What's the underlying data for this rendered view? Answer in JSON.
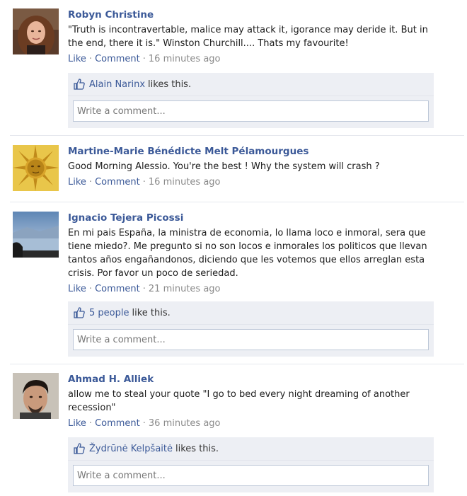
{
  "posts": [
    {
      "author": "Robyn Christine",
      "text": "\"Truth is incontravertable, malice may attack it, igorance may deride it. But in the end, there it is.\" Winston Churchill.... Thats my favourite!",
      "like_label": "Like",
      "comment_label": "Comment",
      "time": "16 minutes ago",
      "likers": "Alain Narinx",
      "likes_suffix": "likes this.",
      "comment_placeholder": "Write a comment..."
    },
    {
      "author": "Martine-Marie Bénédicte Melt Pélamourgues",
      "text": "Good Morning Alessio. You're the best ! Why the system will crash ?",
      "like_label": "Like",
      "comment_label": "Comment",
      "time": "16 minutes ago"
    },
    {
      "author": "Ignacio Tejera Picossi",
      "text": "En mi pais España, la ministra de economia, lo llama loco e inmoral, sera que tiene miedo?. Me pregunto si no son locos e inmorales los politicos que llevan tantos años engañandonos, diciendo que les votemos que ellos arreglan esta crisis. Por favor un poco de seriedad.",
      "like_label": "Like",
      "comment_label": "Comment",
      "time": "21 minutes ago",
      "likers": "5 people",
      "likes_suffix": "like this.",
      "comment_placeholder": "Write a comment..."
    },
    {
      "author": "Ahmad H. Alliek",
      "text": "allow me to steal your quote \"I go to bed every night dreaming of another recession\"",
      "like_label": "Like",
      "comment_label": "Comment",
      "time": "36 minutes ago",
      "likers": "Žydrūnė Kelpšaitė",
      "likes_suffix": "likes this.",
      "comment_placeholder": "Write a comment..."
    }
  ],
  "colors": {
    "link": "#3b5998",
    "meta": "#8a8a8a",
    "likes_bg": "#edeff4",
    "input_border": "#bdc7d8"
  },
  "icons": {
    "like": "thumbs-up-icon"
  }
}
